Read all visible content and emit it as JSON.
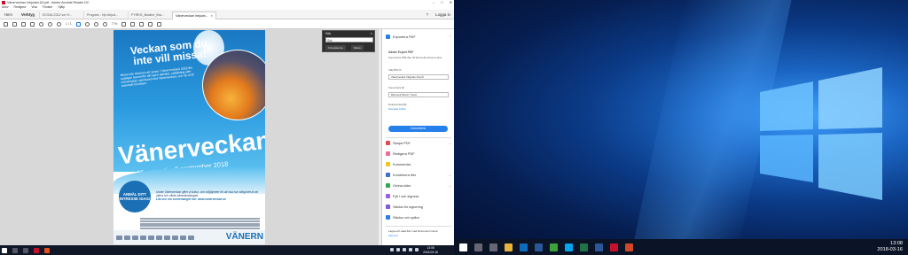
{
  "window": {
    "title": "Vänerveckan Inbjudan A3.pdf - Adobe Acrobat Reader DC",
    "controls": [
      "–",
      "□",
      "✕"
    ]
  },
  "menubar": [
    "Arkiv",
    "Redigera",
    "Visa",
    "Fönster",
    "Hjälp"
  ],
  "tabs": {
    "home": "Hem",
    "tools": "Verktyg",
    "documents": [
      "ECS46-2312 ver H...",
      "Program - Ny inbjud...",
      "PYREG_Bosline_Bra...",
      "Vänerveckan Inbjudn..."
    ],
    "close": "×",
    "help": "?",
    "login": "Logga in"
  },
  "toolbar": {
    "page_count": "1 / 1",
    "zoom": "77%"
  },
  "find": {
    "title": "Sök",
    "close": "×",
    "query": "Sök",
    "prev_label": "Föregående",
    "next_label": "Nästa"
  },
  "poster": {
    "headline": "Veckan som du inte vill missa!",
    "promo": "Missa inte chansen att synas i Vänerveckans 2018 års upplaga! Genomför din egen aktivitet, utställning eller evenemang i samband med Vänerveckan, och nå ut till tusentals besökare.",
    "brand": "Vänerveckan",
    "dates": "25 augusti – 2 september 2018",
    "badge": "ANMÄL DITT INTRESSE IDAG!",
    "info": "Under Vänerveckan lyfter vi kultur- och möjligheter för att visa hur viktigt det är att värna och vårda vänerlandskapet.",
    "url": "Läs mer om evenemanget här: www.vanerveckan.se",
    "footer_brand": "VÄNERN",
    "footer_tag": "Förse att se"
  },
  "right_pane": {
    "export_title": "Exportera PDF",
    "export_product": "Adobe Export PDF",
    "export_desc": "Konvertera PDF-filer till Word eller Excel online",
    "select_label": "Välj PDF-fil",
    "file_name": "Vänerveckan Inbjudan A3.pdf",
    "convert_label": "Konvertera till",
    "convert_value": "Microsoft Word (*.docx)",
    "lang_label": "Dokumentspråk:",
    "lang_value": "Svenska Ändra",
    "convert_button": "Konvertera",
    "tools": [
      "Skapa PDF",
      "Redigera PDF",
      "Kommentar",
      "Kombinera filer",
      "Ordna sidor",
      "Fyll i och signera",
      "Skicka för signering",
      "Skicka och spåra"
    ],
    "storage_text": "Lagra och dela filer med Document Cloud",
    "storage_link": "Läs mer"
  },
  "taskbar_left": {
    "time": "13:08",
    "date": "2018-03-16"
  },
  "taskbar_right": {
    "time": "13:08",
    "date": "2018-03-16"
  },
  "colors": {
    "accent": "#2680eb",
    "pdf_red": "#c8102e"
  }
}
